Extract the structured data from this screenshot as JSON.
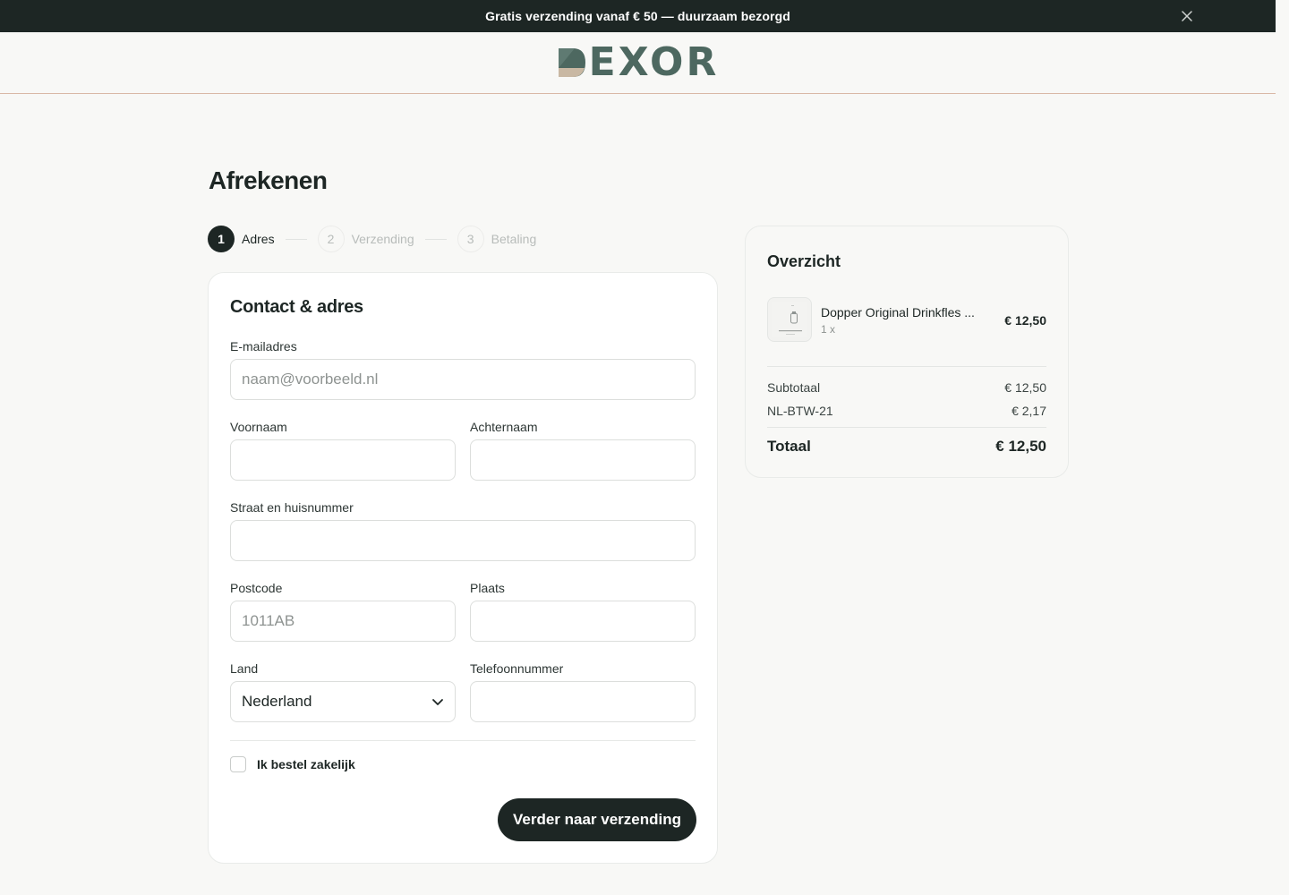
{
  "announcement": {
    "text": "Gratis verzending vanaf € 50 — duurzaam bezorgd",
    "close_icon": "close-icon"
  },
  "header": {
    "logo_text": "EXOR",
    "colors": {
      "logo": "#4d6860",
      "mark_dark": "#4d6860",
      "mark_light": "#c9b8a3",
      "accent_line": "#d9b8a6"
    }
  },
  "page": {
    "title": "Afrekenen"
  },
  "steps": [
    {
      "number": "1",
      "label": "Adres",
      "state": "active"
    },
    {
      "number": "2",
      "label": "Verzending",
      "state": "inactive"
    },
    {
      "number": "3",
      "label": "Betaling",
      "state": "inactive"
    }
  ],
  "form": {
    "title": "Contact & adres",
    "email": {
      "label": "E-mailadres",
      "placeholder": "naam@voorbeeld.nl",
      "value": ""
    },
    "first_name": {
      "label": "Voornaam",
      "placeholder": "",
      "value": ""
    },
    "last_name": {
      "label": "Achternaam",
      "placeholder": "",
      "value": ""
    },
    "street": {
      "label": "Straat en huisnummer",
      "placeholder": "",
      "value": ""
    },
    "postcode": {
      "label": "Postcode",
      "placeholder": "1011AB",
      "value": ""
    },
    "city": {
      "label": "Plaats",
      "placeholder": "",
      "value": ""
    },
    "country": {
      "label": "Land",
      "value": "Nederland",
      "icon": "chevron-down-icon"
    },
    "phone": {
      "label": "Telefoonnummer",
      "placeholder": "",
      "value": ""
    },
    "business_checkbox": {
      "label": "Ik bestel zakelijk",
      "checked": false
    },
    "submit_label": "Verder naar verzending"
  },
  "summary": {
    "title": "Overzicht",
    "items": [
      {
        "name": "Dopper Original Drinkfles ...",
        "qty": "1 x",
        "price": "€ 12,50",
        "thumb_icon": "bottle-thumbnail-icon"
      }
    ],
    "subtotal_label": "Subtotaal",
    "subtotal_value": "€ 12,50",
    "tax_label": "NL-BTW-21",
    "tax_value": "€ 2,17",
    "total_label": "Totaal",
    "total_value": "€ 12,50"
  }
}
